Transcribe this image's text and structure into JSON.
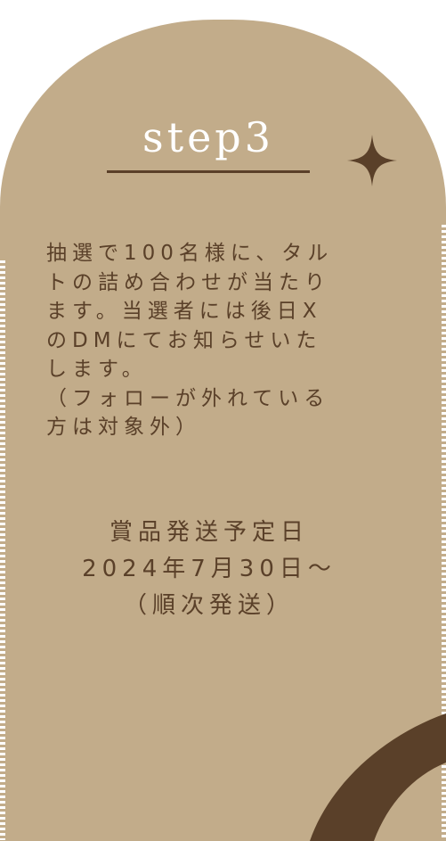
{
  "step": {
    "title": "step3"
  },
  "description": {
    "lines": [
      "抽選で100名様に、タル",
      "トの詰め合わせが当たり",
      "ます。当選者には後日X",
      "のDMにてお知らせいた",
      "します。",
      "（フォローが外れている",
      "方は対象外）"
    ]
  },
  "schedule": {
    "lines": [
      "賞品発送予定日",
      "2024年7月30日～",
      "（順次発送）"
    ]
  },
  "icons": {
    "sparkle": "sparkle-icon"
  },
  "colors": {
    "card_background": "#c2ac8a",
    "text_dark_brown": "#5a4029",
    "title_white": "#ffffff",
    "accent_dark": "#5a4029"
  }
}
